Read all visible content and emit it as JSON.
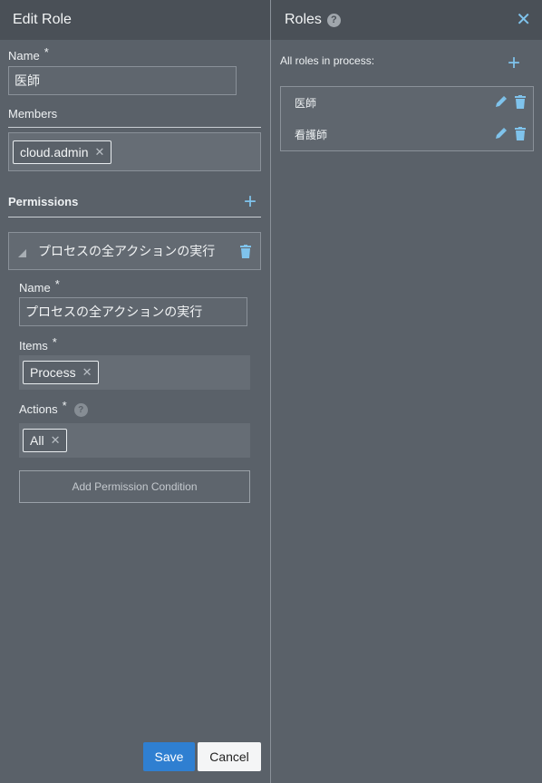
{
  "edit_role": {
    "title": "Edit Role",
    "name_label": "Name",
    "required_mark": "*",
    "name_value": "医師",
    "members_label": "Members",
    "members": [
      "cloud.admin"
    ],
    "permissions_title": "Permissions",
    "permission": {
      "label": "プロセスの全アクションの実行",
      "name_label": "Name",
      "name_value": "プロセスの全アクションの実行",
      "items_label": "Items",
      "items": [
        "Process"
      ],
      "actions_label": "Actions",
      "actions": [
        "All"
      ],
      "add_condition_label": "Add Permission Condition"
    },
    "save_label": "Save",
    "cancel_label": "Cancel"
  },
  "roles": {
    "title": "Roles",
    "help_glyph": "?",
    "close_glyph": "✕",
    "all_roles_label": "All roles in process:",
    "items": [
      {
        "name": "医師"
      },
      {
        "name": "看護師"
      }
    ]
  },
  "colors": {
    "accent": "#7fc3ec",
    "primary_button": "#2f7fd1",
    "panel_bg": "#5a6169",
    "header_bg": "#4a5057"
  },
  "icons": {
    "plus": "+",
    "remove": "✕",
    "help": "?"
  }
}
